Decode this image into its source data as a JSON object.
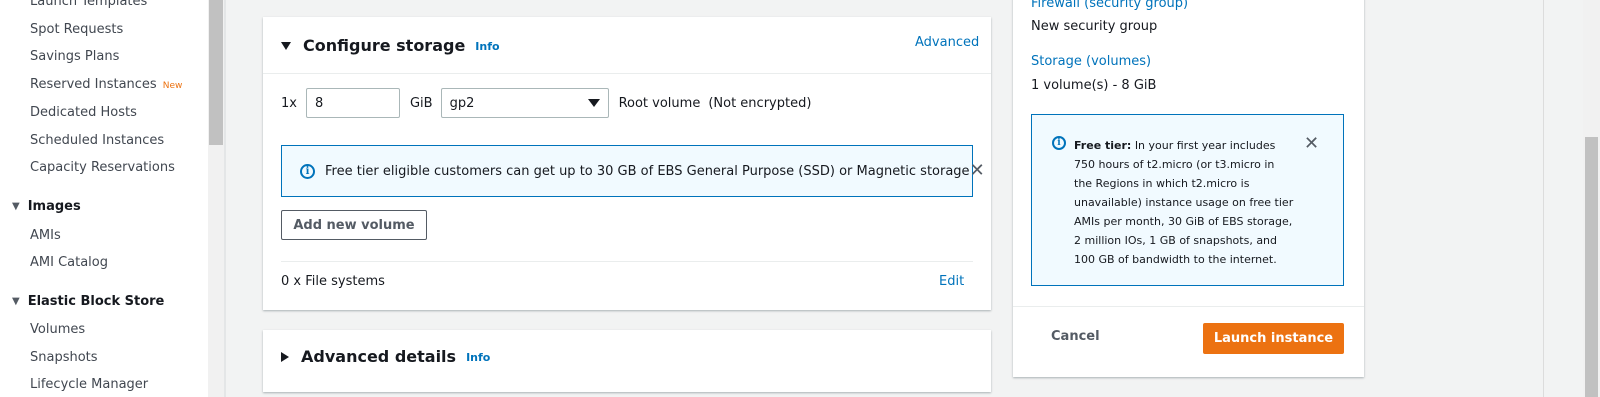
{
  "sidebar": {
    "items": [
      {
        "label": "Launch Templates"
      },
      {
        "label": "Spot Requests"
      },
      {
        "label": "Savings Plans"
      },
      {
        "label": "Reserved Instances",
        "badge": "New"
      },
      {
        "label": "Dedicated Hosts"
      },
      {
        "label": "Scheduled Instances"
      },
      {
        "label": "Capacity Reservations"
      }
    ],
    "images_section": {
      "title": "Images",
      "items": [
        "AMIs",
        "AMI Catalog"
      ]
    },
    "ebs_section": {
      "title": "Elastic Block Store",
      "items": [
        "Volumes",
        "Snapshots",
        "Lifecycle Manager"
      ]
    }
  },
  "storage": {
    "title": "Configure storage",
    "info": "Info",
    "advanced": "Advanced",
    "count": "1x",
    "size_value": "8",
    "unit": "GiB",
    "volume_type": "gp2",
    "root_label": "Root volume",
    "encryption": "(Not encrypted)",
    "alert_text": "Free tier eligible customers can get up to 30 GB of EBS General Purpose (SSD) or Magnetic storage",
    "add_volume": "Add new volume",
    "file_systems": "0 x File systems",
    "edit": "Edit"
  },
  "advanced_details": {
    "title": "Advanced details",
    "info": "Info"
  },
  "summary": {
    "firewall_label": "Firewall (security group)",
    "firewall_value": "New security group",
    "storage_label": "Storage (volumes)",
    "storage_value": "1 volume(s) - 8 GiB",
    "free_tier_title": "Free tier:",
    "free_tier_text": "In your first year includes 750 hours of t2.micro (or t3.micro in the Regions in which t2.micro is unavailable) instance usage on free tier AMIs per month, 30 GiB of EBS storage, 2 million IOs, 1 GB of snapshots, and 100 GB of bandwidth to the internet.",
    "cancel": "Cancel",
    "launch": "Launch instance"
  },
  "colors": {
    "accent": "#0073bb",
    "primary_button": "#ec7211",
    "info_bg": "#f1faff"
  },
  "icons": [
    "info-icon",
    "close-icon",
    "caret-down-icon",
    "expand-triangle-icon",
    "collapse-triangle-icon"
  ]
}
